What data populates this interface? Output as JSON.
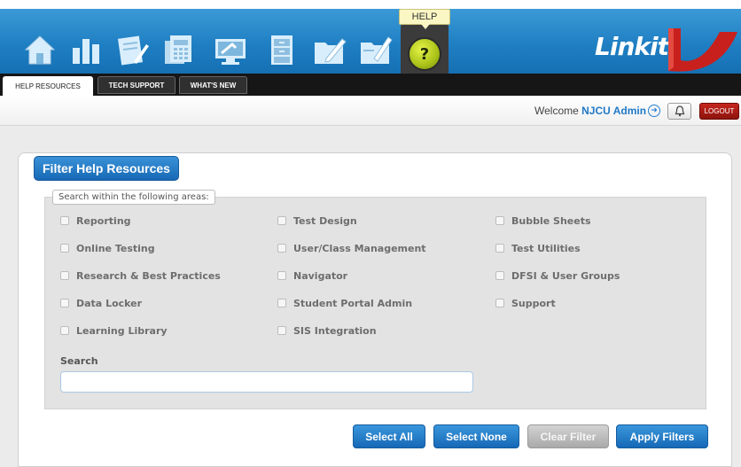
{
  "header": {
    "nav_icons": [
      "home-icon",
      "bar-chart-icon",
      "pencil-document-icon",
      "calculator-icon",
      "monitor-icon",
      "file-cabinet-icon",
      "edit-folder-icon",
      "folder-pencil-icon"
    ],
    "help_tooltip": "HELP",
    "help_icon": "question-mark-icon",
    "logo_text": "Linkit!",
    "brand_color": "#1f7fc3",
    "logo_color": "#c8201d"
  },
  "tabs": [
    {
      "label": "HELP RESOURCES",
      "active": true
    },
    {
      "label": "TECH SUPPORT",
      "active": false
    },
    {
      "label": "WHAT'S NEW",
      "active": false
    }
  ],
  "userbar": {
    "welcome_prefix": "Welcome",
    "user_name": "NJCU Admin",
    "arrow_icon": "circle-arrow-right-icon",
    "bell_icon": "bell-icon",
    "logout_label": "LOGOUT"
  },
  "panel": {
    "title": "Filter Help Resources",
    "areas_label": "Search within the following areas:",
    "checkboxes": [
      {
        "label": "Reporting",
        "checked": false
      },
      {
        "label": "Test Design",
        "checked": false
      },
      {
        "label": "Bubble Sheets",
        "checked": false
      },
      {
        "label": "Online Testing",
        "checked": false
      },
      {
        "label": "User/Class Management",
        "checked": false
      },
      {
        "label": "Test Utilities",
        "checked": false
      },
      {
        "label": "Research & Best Practices",
        "checked": false
      },
      {
        "label": "Navigator",
        "checked": false
      },
      {
        "label": "DFSI & User Groups",
        "checked": false
      },
      {
        "label": "Data Locker",
        "checked": false
      },
      {
        "label": "Student Portal Admin",
        "checked": false
      },
      {
        "label": "Support",
        "checked": false
      },
      {
        "label": "Learning Library",
        "checked": false
      },
      {
        "label": "SIS Integration",
        "checked": false
      }
    ],
    "search_label": "Search",
    "search_value": "",
    "buttons": {
      "select_all": "Select All",
      "select_none": "Select None",
      "clear_filter": "Clear Filter",
      "apply_filters": "Apply Filters"
    }
  }
}
